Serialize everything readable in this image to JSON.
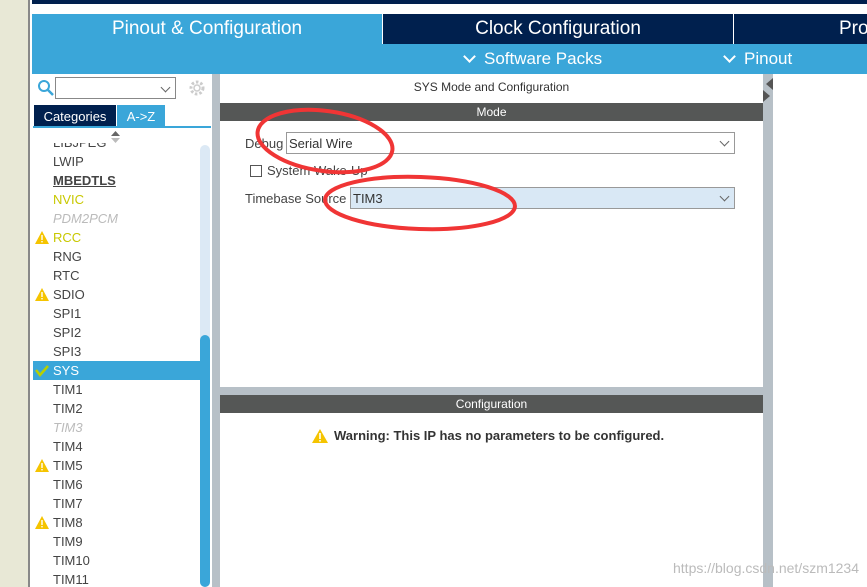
{
  "tabs": [
    {
      "label": "Pinout & Configuration",
      "active": true
    },
    {
      "label": "Clock Configuration",
      "active": false
    },
    {
      "label": "Pro",
      "active": false
    }
  ],
  "subbar": {
    "software_packs": "Software Packs",
    "pinout": "Pinout"
  },
  "left": {
    "search_value": "",
    "view_tabs": [
      {
        "label": "Categories",
        "active": false
      },
      {
        "label": "A->Z",
        "active": true
      }
    ],
    "items": [
      {
        "label": "LIBJPEG",
        "status": "none",
        "style": "normal"
      },
      {
        "label": "LWIP",
        "status": "none",
        "style": "normal"
      },
      {
        "label": "MBEDTLS",
        "status": "none",
        "style": "bold-underline"
      },
      {
        "label": "NVIC",
        "status": "none",
        "style": "yellow"
      },
      {
        "label": "PDM2PCM",
        "status": "none",
        "style": "disabled"
      },
      {
        "label": "RCC",
        "status": "warning",
        "style": "yellow"
      },
      {
        "label": "RNG",
        "status": "none",
        "style": "normal"
      },
      {
        "label": "RTC",
        "status": "none",
        "style": "normal"
      },
      {
        "label": "SDIO",
        "status": "warning",
        "style": "normal"
      },
      {
        "label": "SPI1",
        "status": "none",
        "style": "normal"
      },
      {
        "label": "SPI2",
        "status": "none",
        "style": "normal"
      },
      {
        "label": "SPI3",
        "status": "none",
        "style": "normal"
      },
      {
        "label": "SYS",
        "status": "check",
        "style": "selected"
      },
      {
        "label": "TIM1",
        "status": "none",
        "style": "normal"
      },
      {
        "label": "TIM2",
        "status": "none",
        "style": "normal"
      },
      {
        "label": "TIM3",
        "status": "none",
        "style": "disabled"
      },
      {
        "label": "TIM4",
        "status": "none",
        "style": "normal"
      },
      {
        "label": "TIM5",
        "status": "warning",
        "style": "normal"
      },
      {
        "label": "TIM6",
        "status": "none",
        "style": "normal"
      },
      {
        "label": "TIM7",
        "status": "none",
        "style": "normal"
      },
      {
        "label": "TIM8",
        "status": "warning",
        "style": "normal"
      },
      {
        "label": "TIM9",
        "status": "none",
        "style": "normal"
      },
      {
        "label": "TIM10",
        "status": "none",
        "style": "normal"
      },
      {
        "label": "TIM11",
        "status": "none",
        "style": "normal"
      }
    ]
  },
  "main": {
    "title": "SYS Mode and Configuration",
    "mode_header": "Mode",
    "debug_label": "Debug",
    "debug_value": "Serial Wire",
    "wakeup_label": "System Wake-Up",
    "wakeup_checked": false,
    "timebase_label": "Timebase Source",
    "timebase_value": "TIM3",
    "config_header": "Configuration",
    "warning": "Warning: This IP has no parameters to be configured."
  },
  "watermark": "https://blog.csdn.net/szm1234",
  "colors": {
    "navy": "#00204e",
    "blue": "#3aa6d9",
    "annotation": "#f03535",
    "warning": "#f5c400"
  }
}
